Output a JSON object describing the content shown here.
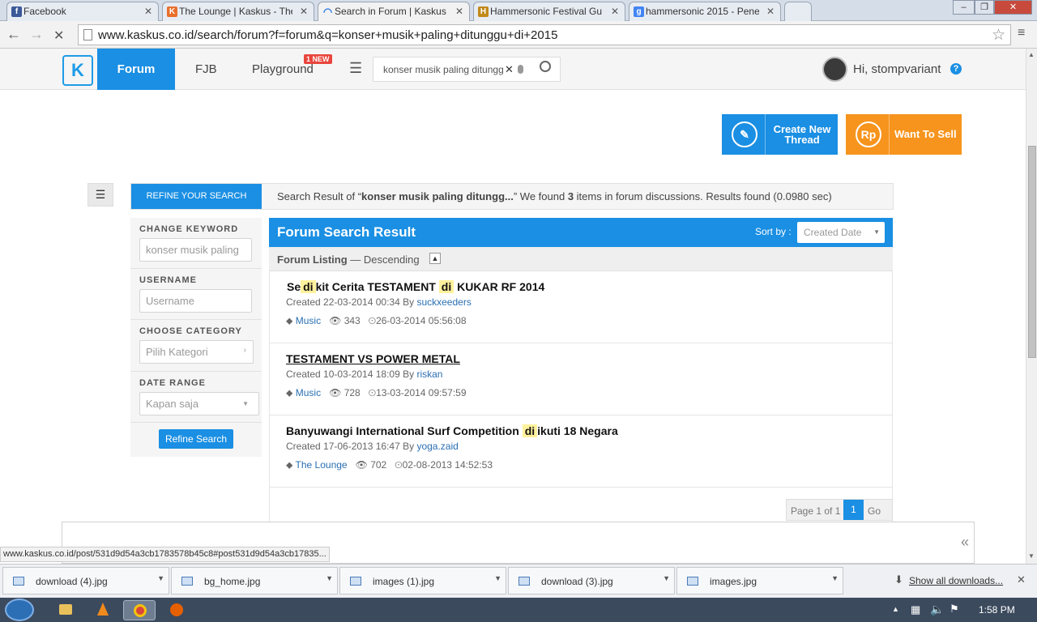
{
  "browser": {
    "tabs": [
      {
        "title": "Facebook",
        "favicon": "facebook-icon",
        "favicon_color": "#3b5998",
        "glyph": "f"
      },
      {
        "title": "The Lounge | Kaskus - The",
        "favicon": "kaskus-icon",
        "favicon_color": "#e96f2c",
        "glyph": "K"
      },
      {
        "title": "Search in Forum | Kaskus -",
        "favicon": "loading-spinner-icon",
        "favicon_color": "#2a7ae2",
        "glyph": "◠"
      },
      {
        "title": "Hammersonic Festival Gu",
        "favicon": "hammersonic-icon",
        "favicon_color": "#c28a1a",
        "glyph": "H"
      },
      {
        "title": "hammersonic 2015 - Pene",
        "favicon": "google-icon",
        "favicon_color": "#4285f4",
        "glyph": "g"
      }
    ],
    "url": "www.kaskus.co.id/search/forum?f=forum&q=konser+musik+paling+ditunggu+di+2015"
  },
  "header": {
    "logo": "K",
    "forum_label": "Forum",
    "fjb_label": "FJB",
    "playground_label": "Playground",
    "new_badge": "1 NEW",
    "search_value": "konser musik paling ditungg",
    "greeting": "Hi, stompvariant",
    "help": "?"
  },
  "actions": {
    "create_thread": "Create New Thread",
    "want_to_sell": "Want To Sell",
    "rp_symbol": "Rp"
  },
  "result_bar": {
    "refine_label": "REFINE YOUR SEARCH",
    "prefix": "Search Result of “",
    "query": "konser musik paling ditungg...",
    "mid": "” We found ",
    "count": "3",
    "suffix": " items in forum discussions. Results found (0.0980 sec)"
  },
  "sidebar": {
    "keyword_label": "CHANGE KEYWORD",
    "keyword_value": "konser musik paling",
    "username_label": "USERNAME",
    "username_placeholder": "Username",
    "category_label": "CHOOSE CATEGORY",
    "category_value": "Pilih Kategori",
    "date_label": "DATE RANGE",
    "date_value": "Kapan saja",
    "refine_button": "Refine Search"
  },
  "main": {
    "title": "Forum Search Result",
    "sort_label": "Sort by :",
    "sort_value": "Created Date",
    "listing_label": "Forum Listing",
    "listing_order": "— Descending"
  },
  "results": [
    {
      "t1": "Se",
      "h1": "di",
      "t2": "kit Cerita TESTAMENT",
      "h2": "di",
      "t3": "KUKAR RF 2014",
      "created": "Created 22-03-2014 00:34 By",
      "author": "suckxeeders",
      "category": "Music",
      "views": "343",
      "last": "26-03-2014 05:56:08"
    },
    {
      "t1": "TESTAMENT VS POWER METAL",
      "h1": "",
      "t2": "",
      "h2": "",
      "t3": "",
      "created": "Created 10-03-2014 18:09 By",
      "author": "riskan",
      "category": "Music",
      "views": "728",
      "last": "13-03-2014 09:57:59"
    },
    {
      "t1": "Banyuwangi International Surf Competition",
      "h1": "di",
      "t2": "ikuti 18 Negara",
      "h2": "",
      "t3": "",
      "created": "Created 17-06-2013 16:47 By",
      "author": "yoga.zaid",
      "category": "The Lounge",
      "views": "702",
      "last": "02-08-2013 14:52:53"
    }
  ],
  "pager": {
    "label": "Page 1 of 1",
    "current": "1",
    "go": "Go"
  },
  "status_url": "www.kaskus.co.id/post/531d9d54a3cb1783578b45c8#post531d9d54a3cb17835...",
  "downloads": [
    "download (4).jpg",
    "bg_home.jpg",
    "images (1).jpg",
    "download (3).jpg",
    "images.jpg"
  ],
  "show_all_downloads": "Show all downloads...",
  "clock": "1:58 PM",
  "colors": {
    "kaskus_blue": "#1a8fe3",
    "sell_orange": "#f7941d",
    "highlight": "#fff19c"
  }
}
